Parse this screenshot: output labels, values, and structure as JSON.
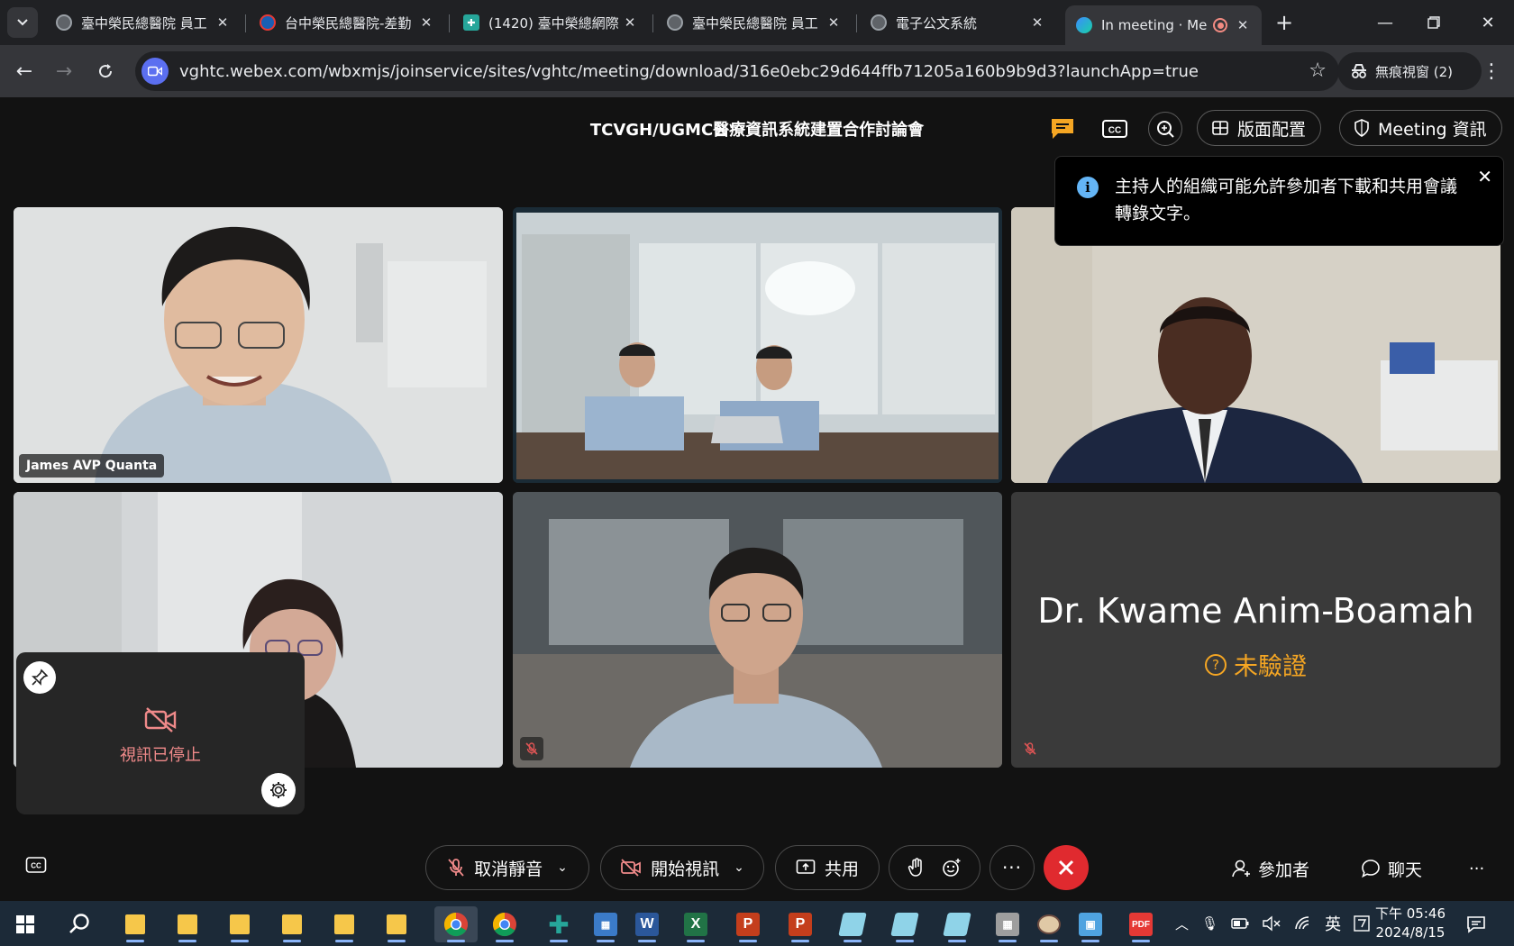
{
  "browser": {
    "tabs": [
      {
        "title": "臺中榮民總醫院 員工",
        "favicon": "globe-icon"
      },
      {
        "title": "台中榮民總醫院-差勤",
        "favicon": "hospital-logo-icon"
      },
      {
        "title": "(1420) 臺中榮總網際",
        "favicon": "cross-icon"
      },
      {
        "title": "臺中榮民總醫院 員工",
        "favicon": "globe-icon"
      },
      {
        "title": "電子公文系統",
        "favicon": "globe-icon"
      },
      {
        "title": "In meeting · Me",
        "favicon": "webex-icon",
        "active": true
      }
    ],
    "url": "vghtc.webex.com/wbxmjs/joinservice/sites/vghtc/meeting/download/316e0ebc29d644ffb71205a160b9b9d3?launchApp=true",
    "incognito_label": "無痕視窗 (2)"
  },
  "meeting": {
    "title": "TCVGH/UGMC醫療資訊系統建置合作討論會",
    "layout_label": "版面配置",
    "info_label": "Meeting 資訊",
    "toast_text": "主持人的組織可能允許參加者下載和共用會議轉錄文字。",
    "participants": [
      {
        "name_tag": "James AVP Quanta",
        "muted": false
      },
      {
        "name_tag": "",
        "muted": false
      },
      {
        "name_tag": "",
        "muted": false
      },
      {
        "name_tag": "",
        "muted": false
      },
      {
        "name_tag": "",
        "muted": true
      },
      {
        "name_tag": "Dr. Kwame Anim-Boamah",
        "muted": true,
        "status": "未驗證"
      }
    ],
    "self_view": {
      "status": "視訊已停止"
    }
  },
  "controls": {
    "unmute": "取消靜音",
    "start_video": "開始視訊",
    "share": "共用",
    "participants": "參加者",
    "chat": "聊天"
  },
  "taskbar": {
    "ime": "英",
    "time": "下午 05:46",
    "date": "2024/8/15"
  },
  "colors": {
    "accent_orange": "#f5a623",
    "leave_red": "#e02a2f",
    "video_stopped": "#f08a8a"
  }
}
